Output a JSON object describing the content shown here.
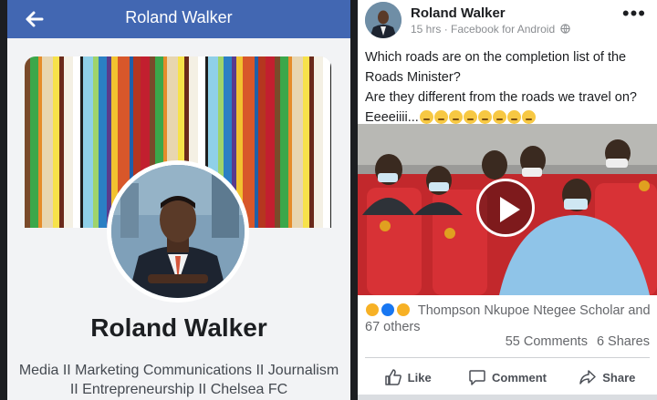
{
  "profile_screen": {
    "header_title": "Roland Walker",
    "name": "Roland Walker",
    "bio": "Media II Marketing Communications II Journalism II Entrepreneurship II Chelsea FC"
  },
  "post": {
    "author": "Roland Walker",
    "time": "15 hrs",
    "source": "Facebook for Android",
    "menu": "•••",
    "text_lines": [
      "Which roads are on the completion list of the Roads Minister?",
      "Are they different from the roads we travel on?",
      "Eeeeiiii..."
    ],
    "reactions_text": "Thompson Nkupoe Ntegee Scholar and 67 others",
    "comments": "55 Comments",
    "shares": "6 Shares",
    "actions": {
      "like": "Like",
      "comment": "Comment",
      "share": "Share"
    }
  },
  "colors": {
    "header_blue": "#4267b2",
    "divider": "#1c1e21",
    "muted": "#65676b"
  },
  "icons": [
    "back-arrow-icon",
    "globe-icon",
    "more-icon",
    "play-icon",
    "like-icon",
    "comment-icon",
    "share-icon"
  ]
}
